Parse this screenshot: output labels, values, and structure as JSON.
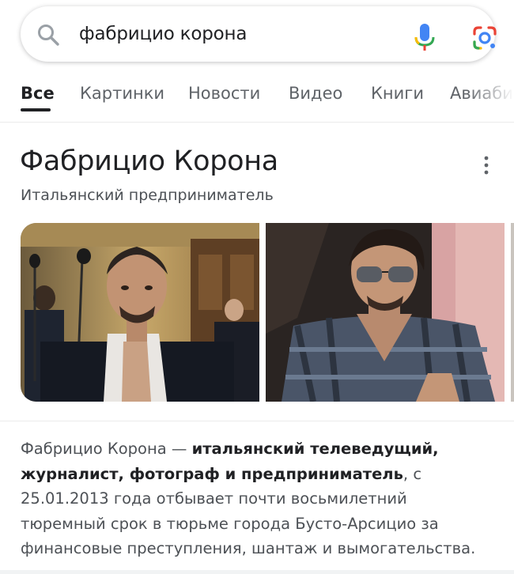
{
  "search": {
    "query": "фабрицио корона",
    "icons": {
      "left": "search-icon",
      "voice": "mic-icon",
      "lens": "google-lens-icon"
    }
  },
  "tabs": [
    {
      "label": "Все",
      "active": true
    },
    {
      "label": "Картинки",
      "active": false
    },
    {
      "label": "Новости",
      "active": false
    },
    {
      "label": "Видео",
      "active": false
    },
    {
      "label": "Книги",
      "active": false
    },
    {
      "label": "Авиабилеты",
      "active": false
    }
  ],
  "knowledge_panel": {
    "title": "Фабрицио Корона",
    "subtitle": "Итальянский предприниматель",
    "menu_icon": "more-vert-icon",
    "images": [
      {
        "subject": "man-in-courtroom-photo"
      },
      {
        "subject": "man-in-sunglasses-plaid-shirt-photo"
      }
    ],
    "description": {
      "lead": "Фабрицио Корона — ",
      "bold": "итальянский телеведущий, журналист, фотограф и предприниматель",
      "rest": ", с 25.01.2013 года отбывает почти восьмилетний тюремный срок в тюрьме города Бусто-Арсицио за финансовые преступления, шантаж и вымогательства."
    }
  },
  "colors": {
    "text_primary": "#202124",
    "text_secondary": "#4d5156",
    "tab_inactive": "#5f6368",
    "google_blue": "#4285f4",
    "google_red": "#ea4335",
    "google_yellow": "#fbbc04",
    "google_green": "#34a853"
  }
}
